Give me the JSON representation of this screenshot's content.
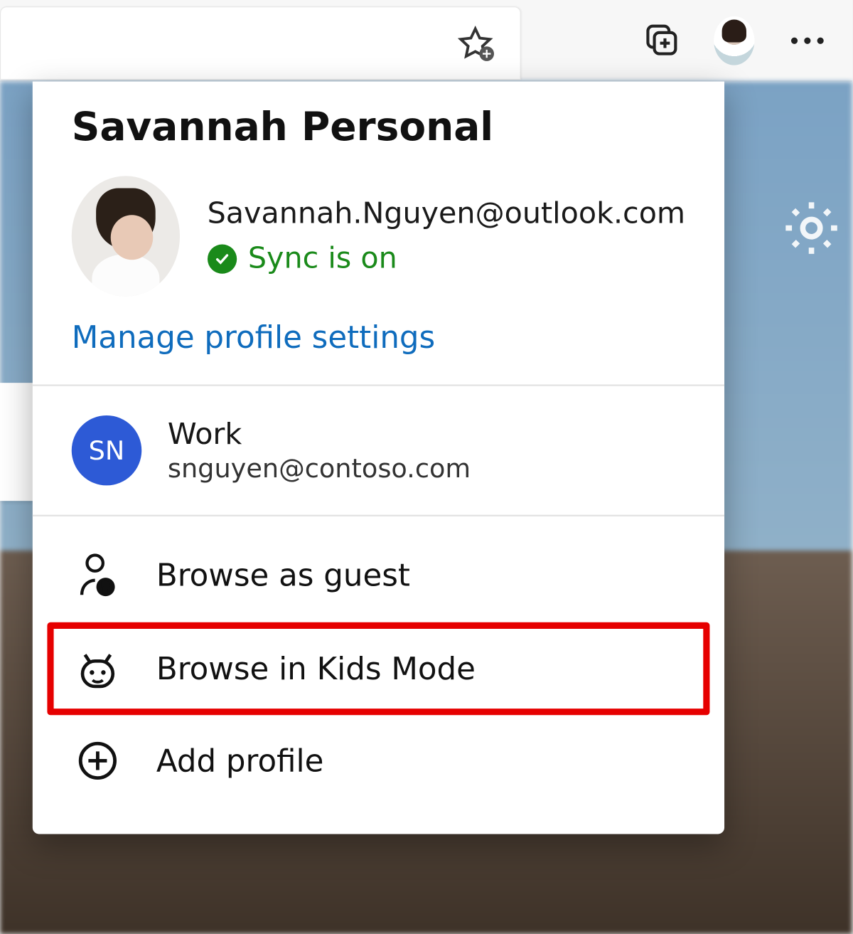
{
  "panel": {
    "title": "Savannah Personal",
    "email": "Savannah.Nguyen@outlook.com",
    "sync_status": "Sync is on",
    "manage_link": "Manage profile settings",
    "other_profile": {
      "name": "Work",
      "initials": "SN",
      "email": "snguyen@contoso.com"
    },
    "actions": {
      "guest": "Browse as guest",
      "kids": "Browse in Kids Mode",
      "add": "Add profile"
    }
  }
}
